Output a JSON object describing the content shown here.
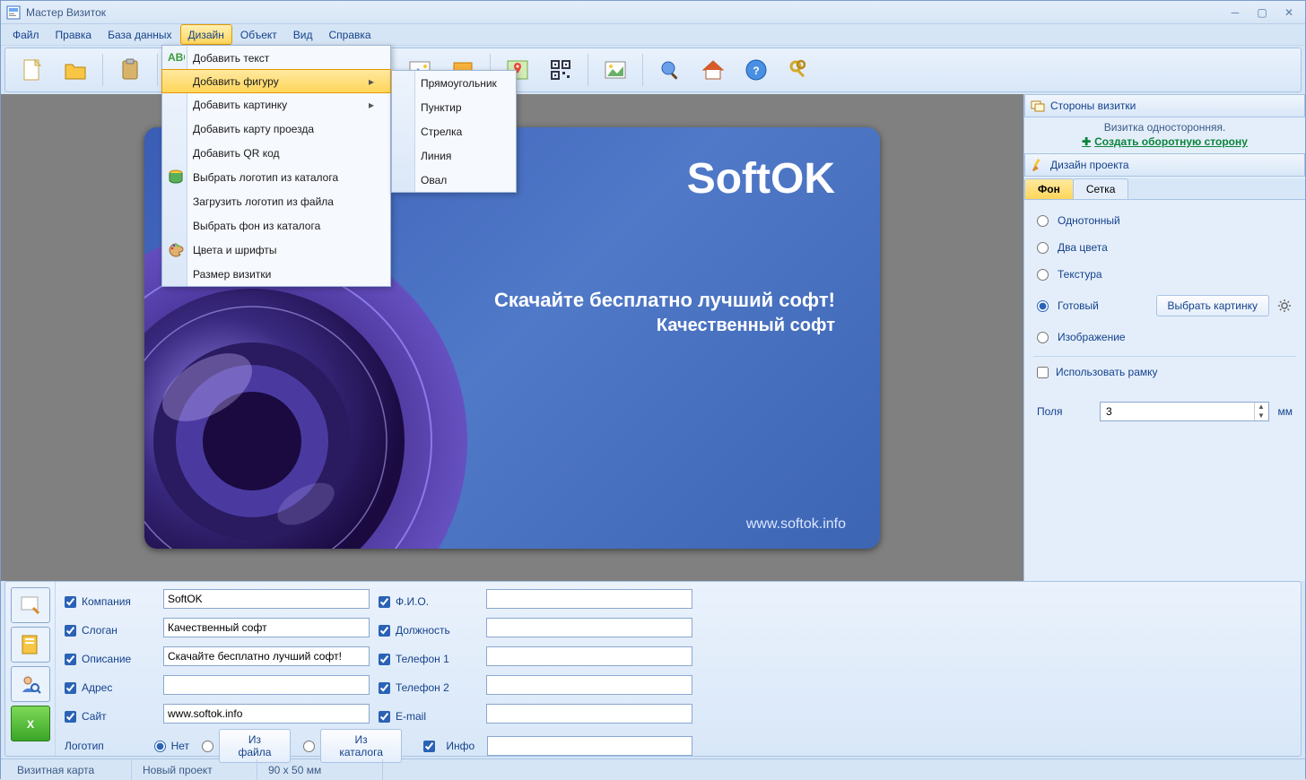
{
  "window": {
    "title": "Мастер Визиток"
  },
  "menubar": [
    "Файл",
    "Правка",
    "База данных",
    "Дизайн",
    "Объект",
    "Вид",
    "Справка"
  ],
  "menubar_active_index": 3,
  "design_menu": {
    "items": [
      {
        "label": "Добавить текст",
        "icon": "abc-icon"
      },
      {
        "label": "Добавить фигуру",
        "arrow": true,
        "highlight": true
      },
      {
        "label": "Добавить картинку",
        "arrow": true
      },
      {
        "label": "Добавить карту проезда"
      },
      {
        "label": "Добавить QR код"
      },
      {
        "label": "Выбрать логотип из каталога",
        "icon": "db-icon"
      },
      {
        "label": "Загрузить логотип из файла"
      },
      {
        "label": "Выбрать фон из каталога"
      },
      {
        "label": "Цвета и шрифты",
        "icon": "palette-icon"
      },
      {
        "label": "Размер визитки"
      }
    ]
  },
  "shape_submenu": [
    "Прямоугольник",
    "Пунктир",
    "Стрелка",
    "Линия",
    "Овал"
  ],
  "card": {
    "brand": "SoftOK",
    "line1": "Скачайте бесплатно лучший софт!",
    "line2": "Качественный софт",
    "site": "www.softok.info"
  },
  "right_panel": {
    "sides_header": "Стороны визитки",
    "side_info": "Визитка односторонняя.",
    "side_link": "Создать оборотную сторону",
    "design_header": "Дизайн проекта",
    "tabs": [
      "Фон",
      "Сетка"
    ],
    "bg_options": [
      "Однотонный",
      "Два цвета",
      "Текстура",
      "Готовый",
      "Изображение"
    ],
    "bg_selected_index": 3,
    "choose_image_btn": "Выбрать картинку",
    "use_frame": "Использовать рамку",
    "margins_label": "Поля",
    "margins_value": "3",
    "margins_unit": "мм"
  },
  "form": {
    "company": {
      "label": "Компания",
      "value": "SoftOK",
      "checked": true
    },
    "slogan": {
      "label": "Слоган",
      "value": "Качественный софт",
      "checked": true
    },
    "desc": {
      "label": "Описание",
      "value": "Скачайте бесплатно лучший софт!",
      "checked": true
    },
    "address": {
      "label": "Адрес",
      "value": "",
      "checked": true
    },
    "site": {
      "label": "Сайт",
      "value": "www.softok.info",
      "checked": true
    },
    "fio": {
      "label": "Ф.И.О.",
      "value": "",
      "checked": true
    },
    "position": {
      "label": "Должность",
      "value": "",
      "checked": true
    },
    "phone1": {
      "label": "Телефон 1",
      "value": "",
      "checked": true
    },
    "phone2": {
      "label": "Телефон 2",
      "value": "",
      "checked": true
    },
    "email": {
      "label": "E-mail",
      "value": "",
      "checked": true
    },
    "info": {
      "label": "Инфо",
      "value": "",
      "checked": true
    },
    "logo": {
      "label": "Логотип",
      "option_none": "Нет",
      "option_file": "Из файла",
      "option_catalog": "Из каталога",
      "selected": "none"
    }
  },
  "statusbar": {
    "cell1": "Визитная карта",
    "cell2": "Новый проект",
    "cell3": "90 x 50 мм"
  }
}
